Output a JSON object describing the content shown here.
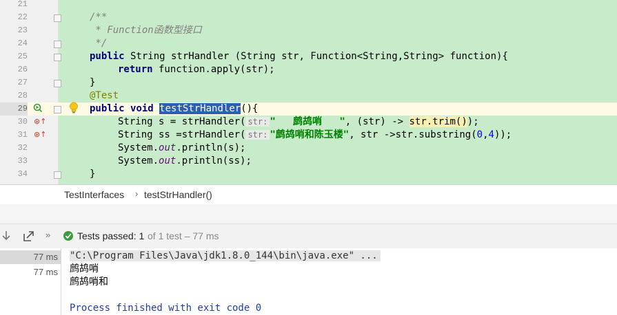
{
  "editor": {
    "line_numbers": [
      "21",
      "22",
      "23",
      "24",
      "25",
      "26",
      "27",
      "28",
      "29",
      "30",
      "31",
      "32",
      "33",
      "34"
    ],
    "code": {
      "l22": "/**",
      "l23_star": " * ",
      "l23_text": "Function函数型接口",
      "l24": " */",
      "l25_kw": "public",
      "l25_rest": " String strHandler (String str, Function<String,String> function){",
      "l26_kw": "return",
      "l26_rest": " function.apply(str);",
      "l27": "}",
      "l28": "@Test",
      "l29_kw1": "public",
      "l29_kw2": "void",
      "l29_method": "testStrHandler",
      "l29_rest": "(){",
      "l30_a": "String s = strHandler(",
      "l30_hint": "str:",
      "l30_str": "\"   鹧鸪哨   \"",
      "l30_b": ", (str) -> ",
      "l30_c": "str.trim()",
      "l30_d": ");",
      "l31_a": "String ss =strHandler(",
      "l31_hint": "str:",
      "l31_str": "\"鹧鸪哨和陈玉楼\"",
      "l31_b": ", str ->str.substring(",
      "l31_n0": "0",
      "l31_comma": ",",
      "l31_n4": "4",
      "l31_end": "));",
      "l32_a": "System.",
      "l32_field": "out",
      "l32_b": ".println(s);",
      "l33_a": "System.",
      "l33_field": "out",
      "l33_b": ".println(ss);",
      "l34": "}"
    }
  },
  "breadcrumb": {
    "class_name": "TestInterfaces",
    "separator": "›",
    "method_name": "testStrHandler()"
  },
  "test_bar": {
    "status_label": "Tests passed:",
    "passed_count": "1",
    "summary": "of 1 test – 77 ms"
  },
  "test_tree": {
    "times": [
      "77 ms",
      "77 ms"
    ]
  },
  "console": {
    "command": "\"C:\\Program Files\\Java\\jdk1.8.0_144\\bin\\java.exe\" ...",
    "output_1": "鹧鸪哨",
    "output_2": "鹧鸪哨和",
    "exit_message": "Process finished with exit code 0"
  },
  "colors": {
    "editor_bg": "#c8ebc9",
    "keyword": "#000080",
    "selection": "#2d5fb3",
    "pass_green": "#3c9b3c"
  },
  "icons": [
    "run-test-icon",
    "lightbulb-icon",
    "implements-icon",
    "fold-icon",
    "scroll-down-icon",
    "export-icon",
    "more-icon",
    "check-circle-icon"
  ]
}
